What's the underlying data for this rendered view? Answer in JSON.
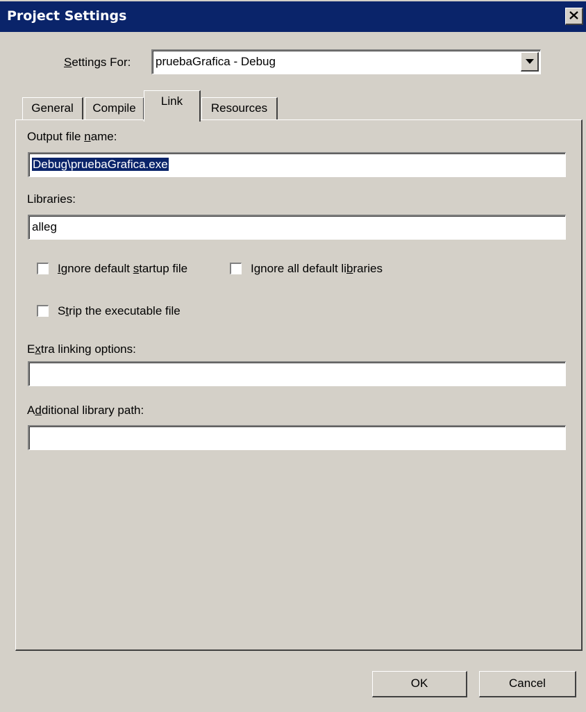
{
  "window": {
    "title": "Project Settings",
    "close_glyph": "close-icon"
  },
  "settings_for": {
    "label_pre": "",
    "label_accel": "S",
    "label_post": "ettings For:",
    "value": "pruebaGrafica - Debug"
  },
  "tabs": [
    {
      "label": "General",
      "active": false
    },
    {
      "label": "Compile",
      "active": false
    },
    {
      "label": "Link",
      "active": true
    },
    {
      "label": "Resources",
      "active": false
    }
  ],
  "link": {
    "output_label_pre": "Output file ",
    "output_label_accel": "n",
    "output_label_post": "ame:",
    "output_value": "Debug\\pruebaGrafica.exe",
    "libraries_label": "Libraries:",
    "libraries_value": "alleg",
    "cb_ignore_startup_pre": "I",
    "cb_ignore_startup_mid": "gnore default ",
    "cb_ignore_startup_accel": "s",
    "cb_ignore_startup_post": "tartup file",
    "cb_ignore_startup_checked": false,
    "cb_ignore_libs_pre": "Ignore all default li",
    "cb_ignore_libs_accel": "b",
    "cb_ignore_libs_post": "raries",
    "cb_ignore_libs_checked": false,
    "cb_strip_pre": "S",
    "cb_strip_accel": "t",
    "cb_strip_post": "rip the executable file",
    "cb_strip_checked": false,
    "extra_label_pre": "E",
    "extra_label_accel": "x",
    "extra_label_post": "tra linking options:",
    "extra_value": "",
    "addpath_label_pre": "A",
    "addpath_label_accel": "d",
    "addpath_label_post": "ditional library path:",
    "addpath_value": ""
  },
  "buttons": {
    "ok": "OK",
    "cancel": "Cancel"
  },
  "colors": {
    "titlebar": "#0a246a",
    "face": "#d4d0c8",
    "selection": "#0a246a"
  }
}
